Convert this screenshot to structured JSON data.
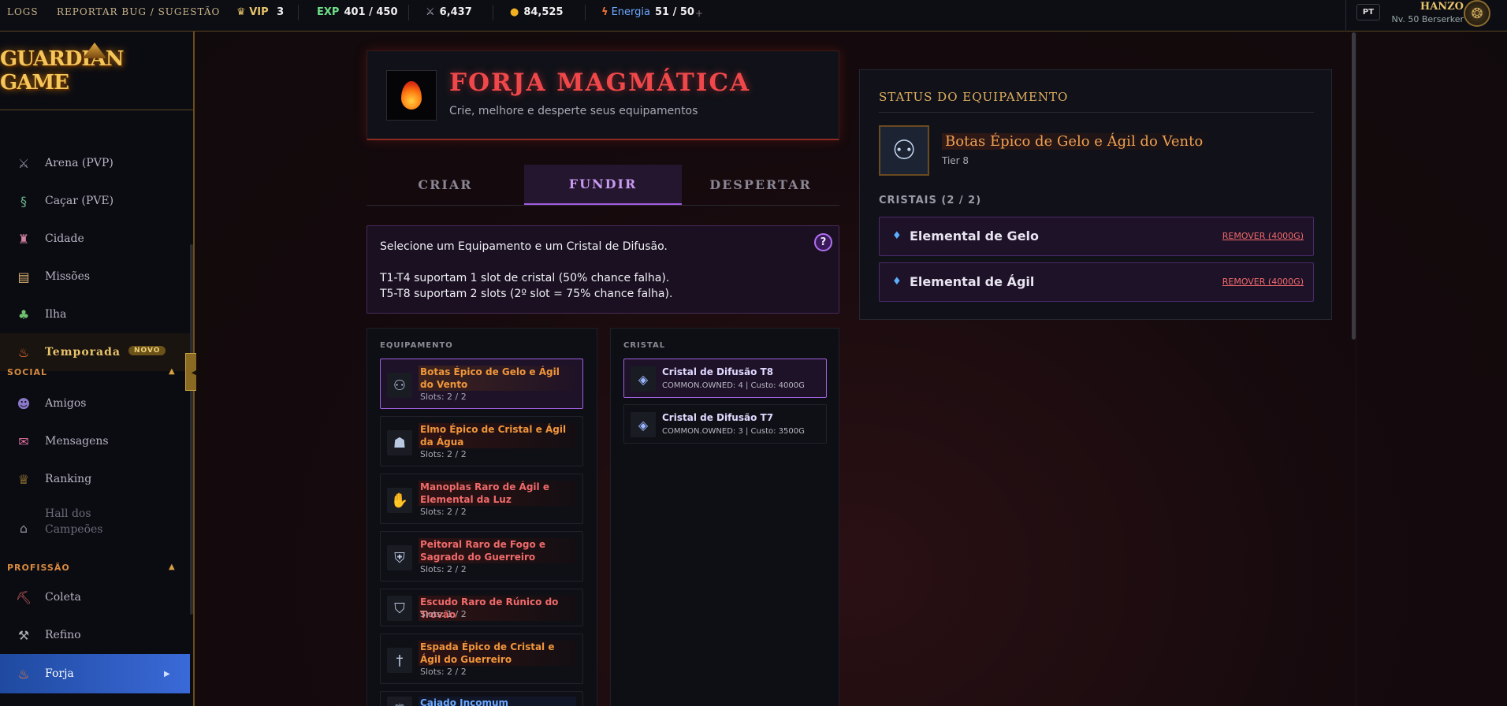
{
  "topbar": {
    "logs": "LOGS",
    "bug": "REPORTAR BUG / SUGESTÃO",
    "vip_label": "VIP",
    "vip_value": "3",
    "exp_label": "EXP",
    "exp_value": "401 / 450",
    "power_value": "6,437",
    "gold_value": "84,525",
    "energy_label": "Energia",
    "energy_value": "51 / 50",
    "energy_plus": "+",
    "lang": "PT",
    "username": "HANZO",
    "level": "Nv. 50 Berserker"
  },
  "sidebar": {
    "logo": "GUARDIAN GAME",
    "items": [
      {
        "label": "Arena (PVP)",
        "icon": "crossed-swords-icon"
      },
      {
        "label": "Caçar (PVE)",
        "icon": "dragon-icon"
      },
      {
        "label": "Cidade",
        "icon": "castle-icon"
      },
      {
        "label": "Missões",
        "icon": "scroll-icon"
      },
      {
        "label": "Ilha",
        "icon": "palm-tree-icon"
      }
    ],
    "temporada": {
      "label": "Temporada",
      "badge": "NOVO"
    },
    "social_section": "SOCIAL",
    "social_items": [
      {
        "label": "Amigos",
        "icon": "friends-icon"
      },
      {
        "label": "Mensagens",
        "icon": "mail-icon"
      },
      {
        "label": "Ranking",
        "icon": "trophy-icon"
      },
      {
        "label": "Hall dos",
        "label2": "Campeões",
        "icon": "temple-icon"
      }
    ],
    "profession_section": "PROFISSÃO",
    "profession_items": [
      {
        "label": "Coleta",
        "icon": "pickaxe-icon"
      },
      {
        "label": "Refino",
        "icon": "hammer-icon"
      },
      {
        "label": "Forja",
        "icon": "flame-icon"
      }
    ],
    "collapse_icon": "◀"
  },
  "forge": {
    "title": "FORJA MAGMÁTICA",
    "subtitle": "Crie, melhore e desperte seus equipamentos",
    "tabs": [
      "CRIAR",
      "FUNDIR",
      "DESPERTAR"
    ],
    "active_tab": "FUNDIR"
  },
  "info": {
    "line1": "Selecione um Equipamento e um Cristal de Difusão.",
    "line2": "T1-T4 suportam 1 slot de cristal (50% chance falha).",
    "line3": "T5-T8 suportam 2 slots (2º slot = 75% chance falha).",
    "help": "?"
  },
  "equipment": {
    "title": "EQUIPAMENTO",
    "items": [
      {
        "name": "Botas Épico de Gelo e Ágil do Vento",
        "slots": "Slots: 2 / 2",
        "rarity": "epic",
        "icon": "boots-icon",
        "selected": true
      },
      {
        "name": "Elmo Épico de Cristal e Ágil da Água",
        "slots": "Slots: 2 / 2",
        "rarity": "epic",
        "icon": "helmet-icon"
      },
      {
        "name": "Manoplas Raro de Ágil e Elemental da Luz",
        "slots": "Slots: 2 / 2",
        "rarity": "rare",
        "icon": "gauntlets-icon"
      },
      {
        "name": "Peitoral Raro de Fogo e Sagrado do Guerreiro",
        "slots": "Slots: 2 / 2",
        "rarity": "rare",
        "icon": "armor-icon"
      },
      {
        "name": "Escudo Raro de Rúnico do Trovão",
        "slots": "Slots: 1 / 2",
        "rarity": "rare",
        "icon": "shield-icon"
      },
      {
        "name": "Espada Épico de Cristal e Ágil do Guerreiro",
        "slots": "Slots: 2 / 2",
        "rarity": "epic",
        "icon": "sword-icon"
      },
      {
        "name": "Cajado Incomum",
        "slots": "",
        "rarity": "common",
        "icon": "staff-icon"
      }
    ]
  },
  "crystal": {
    "title": "CRISTAL",
    "items": [
      {
        "name": "Cristal de Difusão T8",
        "meta": "COMMON.OWNED: 4 | Custo: 4000G",
        "selected": true
      },
      {
        "name": "Cristal de Difusão T7",
        "meta": "COMMON.OWNED: 3 | Custo: 3500G"
      }
    ]
  },
  "status": {
    "title": "STATUS DO EQUIPAMENTO",
    "item_name": "Botas Épico de Gelo e Ágil do Vento",
    "tier": "Tier 8",
    "crystals_header": "CRISTAIS (2 / 2)",
    "slots": [
      {
        "name": "Elemental de Gelo",
        "remove": "REMOVER (4000G)"
      },
      {
        "name": "Elemental de Ágil",
        "remove": "REMOVER (4000G)"
      }
    ]
  },
  "colors": {
    "epic": "#f0963a",
    "rare": "#f06a6a",
    "common": "#6aa8ff",
    "accent": "#a25ce0",
    "forge_title": "#f0484a"
  }
}
